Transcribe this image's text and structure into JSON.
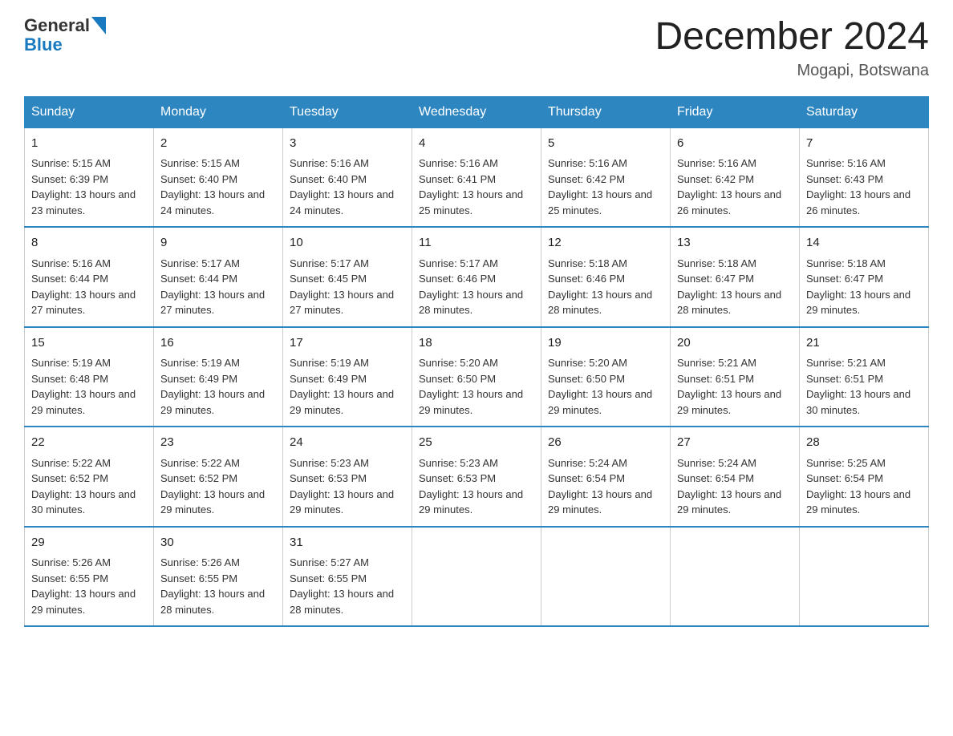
{
  "header": {
    "logo_general": "General",
    "logo_blue": "Blue",
    "month_title": "December 2024",
    "location": "Mogapi, Botswana"
  },
  "days_of_week": [
    "Sunday",
    "Monday",
    "Tuesday",
    "Wednesday",
    "Thursday",
    "Friday",
    "Saturday"
  ],
  "weeks": [
    [
      {
        "day": "1",
        "sunrise": "5:15 AM",
        "sunset": "6:39 PM",
        "daylight": "13 hours and 23 minutes."
      },
      {
        "day": "2",
        "sunrise": "5:15 AM",
        "sunset": "6:40 PM",
        "daylight": "13 hours and 24 minutes."
      },
      {
        "day": "3",
        "sunrise": "5:16 AM",
        "sunset": "6:40 PM",
        "daylight": "13 hours and 24 minutes."
      },
      {
        "day": "4",
        "sunrise": "5:16 AM",
        "sunset": "6:41 PM",
        "daylight": "13 hours and 25 minutes."
      },
      {
        "day": "5",
        "sunrise": "5:16 AM",
        "sunset": "6:42 PM",
        "daylight": "13 hours and 25 minutes."
      },
      {
        "day": "6",
        "sunrise": "5:16 AM",
        "sunset": "6:42 PM",
        "daylight": "13 hours and 26 minutes."
      },
      {
        "day": "7",
        "sunrise": "5:16 AM",
        "sunset": "6:43 PM",
        "daylight": "13 hours and 26 minutes."
      }
    ],
    [
      {
        "day": "8",
        "sunrise": "5:16 AM",
        "sunset": "6:44 PM",
        "daylight": "13 hours and 27 minutes."
      },
      {
        "day": "9",
        "sunrise": "5:17 AM",
        "sunset": "6:44 PM",
        "daylight": "13 hours and 27 minutes."
      },
      {
        "day": "10",
        "sunrise": "5:17 AM",
        "sunset": "6:45 PM",
        "daylight": "13 hours and 27 minutes."
      },
      {
        "day": "11",
        "sunrise": "5:17 AM",
        "sunset": "6:46 PM",
        "daylight": "13 hours and 28 minutes."
      },
      {
        "day": "12",
        "sunrise": "5:18 AM",
        "sunset": "6:46 PM",
        "daylight": "13 hours and 28 minutes."
      },
      {
        "day": "13",
        "sunrise": "5:18 AM",
        "sunset": "6:47 PM",
        "daylight": "13 hours and 28 minutes."
      },
      {
        "day": "14",
        "sunrise": "5:18 AM",
        "sunset": "6:47 PM",
        "daylight": "13 hours and 29 minutes."
      }
    ],
    [
      {
        "day": "15",
        "sunrise": "5:19 AM",
        "sunset": "6:48 PM",
        "daylight": "13 hours and 29 minutes."
      },
      {
        "day": "16",
        "sunrise": "5:19 AM",
        "sunset": "6:49 PM",
        "daylight": "13 hours and 29 minutes."
      },
      {
        "day": "17",
        "sunrise": "5:19 AM",
        "sunset": "6:49 PM",
        "daylight": "13 hours and 29 minutes."
      },
      {
        "day": "18",
        "sunrise": "5:20 AM",
        "sunset": "6:50 PM",
        "daylight": "13 hours and 29 minutes."
      },
      {
        "day": "19",
        "sunrise": "5:20 AM",
        "sunset": "6:50 PM",
        "daylight": "13 hours and 29 minutes."
      },
      {
        "day": "20",
        "sunrise": "5:21 AM",
        "sunset": "6:51 PM",
        "daylight": "13 hours and 29 minutes."
      },
      {
        "day": "21",
        "sunrise": "5:21 AM",
        "sunset": "6:51 PM",
        "daylight": "13 hours and 30 minutes."
      }
    ],
    [
      {
        "day": "22",
        "sunrise": "5:22 AM",
        "sunset": "6:52 PM",
        "daylight": "13 hours and 30 minutes."
      },
      {
        "day": "23",
        "sunrise": "5:22 AM",
        "sunset": "6:52 PM",
        "daylight": "13 hours and 29 minutes."
      },
      {
        "day": "24",
        "sunrise": "5:23 AM",
        "sunset": "6:53 PM",
        "daylight": "13 hours and 29 minutes."
      },
      {
        "day": "25",
        "sunrise": "5:23 AM",
        "sunset": "6:53 PM",
        "daylight": "13 hours and 29 minutes."
      },
      {
        "day": "26",
        "sunrise": "5:24 AM",
        "sunset": "6:54 PM",
        "daylight": "13 hours and 29 minutes."
      },
      {
        "day": "27",
        "sunrise": "5:24 AM",
        "sunset": "6:54 PM",
        "daylight": "13 hours and 29 minutes."
      },
      {
        "day": "28",
        "sunrise": "5:25 AM",
        "sunset": "6:54 PM",
        "daylight": "13 hours and 29 minutes."
      }
    ],
    [
      {
        "day": "29",
        "sunrise": "5:26 AM",
        "sunset": "6:55 PM",
        "daylight": "13 hours and 29 minutes."
      },
      {
        "day": "30",
        "sunrise": "5:26 AM",
        "sunset": "6:55 PM",
        "daylight": "13 hours and 28 minutes."
      },
      {
        "day": "31",
        "sunrise": "5:27 AM",
        "sunset": "6:55 PM",
        "daylight": "13 hours and 28 minutes."
      },
      null,
      null,
      null,
      null
    ]
  ]
}
